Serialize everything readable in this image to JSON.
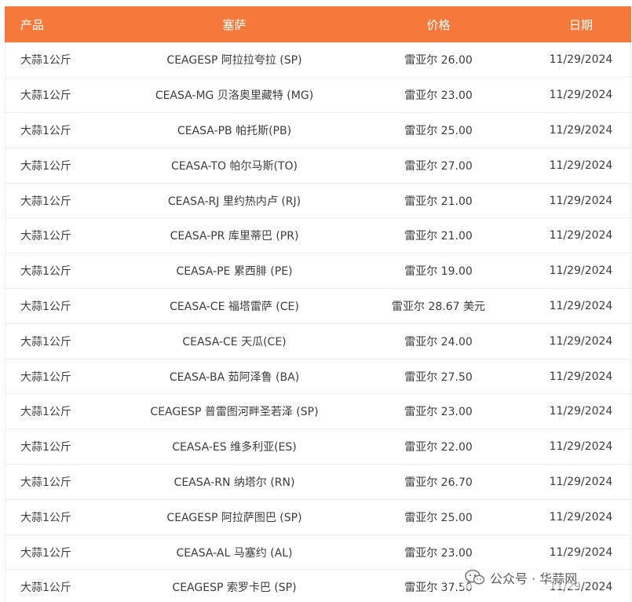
{
  "table": {
    "headers": {
      "product": "产品",
      "market": "塞萨",
      "price": "价格",
      "date": "日期"
    },
    "rows": [
      {
        "product": "大蒜1公斤",
        "market": "CEAGESP 阿拉拉夸拉 (SP)",
        "price": "雷亚尔 26.00",
        "date": "11/29/2024"
      },
      {
        "product": "大蒜1公斤",
        "market": "CEASA-MG 贝洛奥里藏特 (MG)",
        "price": "雷亚尔 23.00",
        "date": "11/29/2024"
      },
      {
        "product": "大蒜1公斤",
        "market": "CEASA-PB 帕托斯(PB)",
        "price": "雷亚尔 25.00",
        "date": "11/29/2024"
      },
      {
        "product": "大蒜1公斤",
        "market": "CEASA-TO 帕尔马斯(TO)",
        "price": "雷亚尔 27.00",
        "date": "11/29/2024"
      },
      {
        "product": "大蒜1公斤",
        "market": "CEASA-RJ 里约热内卢 (RJ)",
        "price": "雷亚尔 21.00",
        "date": "11/29/2024"
      },
      {
        "product": "大蒜1公斤",
        "market": "CEASA-PR 库里蒂巴 (PR)",
        "price": "雷亚尔 21.00",
        "date": "11/29/2024"
      },
      {
        "product": "大蒜1公斤",
        "market": "CEASA-PE 累西腓 (PE)",
        "price": "雷亚尔 19.00",
        "date": "11/29/2024"
      },
      {
        "product": "大蒜1公斤",
        "market": "CEASA-CE 福塔雷萨 (CE)",
        "price": "雷亚尔 28.67 美元",
        "date": "11/29/2024"
      },
      {
        "product": "大蒜1公斤",
        "market": "CEASA-CE 天瓜(CE)",
        "price": "雷亚尔 24.00",
        "date": "11/29/2024"
      },
      {
        "product": "大蒜1公斤",
        "market": "CEASA-BA 茹阿泽鲁 (BA)",
        "price": "雷亚尔 27.50",
        "date": "11/29/2024"
      },
      {
        "product": "大蒜1公斤",
        "market": "CEAGESP 普雷图河畔圣若泽 (SP)",
        "price": "雷亚尔 23.00",
        "date": "11/29/2024"
      },
      {
        "product": "大蒜1公斤",
        "market": "CEASA-ES 维多利亚(ES)",
        "price": "雷亚尔 22.00",
        "date": "11/29/2024"
      },
      {
        "product": "大蒜1公斤",
        "market": "CEASA-RN 纳塔尔 (RN)",
        "price": "雷亚尔 26.70",
        "date": "11/29/2024"
      },
      {
        "product": "大蒜1公斤",
        "market": "CEAGESP 阿拉萨图巴 (SP)",
        "price": "雷亚尔 25.00",
        "date": "11/29/2024"
      },
      {
        "product": "大蒜1公斤",
        "market": "CEASA-AL 马塞约 (AL)",
        "price": "雷亚尔 23.00",
        "date": "11/29/2024"
      },
      {
        "product": "大蒜1公斤",
        "market": "CEAGESP 索罗卡巴 (SP)",
        "price": "雷亚尔 37.50",
        "date": "11/29/2024"
      }
    ]
  },
  "watermark": {
    "text": "公众号 · 华蒜网",
    "icon": "wechat-icon"
  },
  "colors": {
    "header_bg": "#f4793a",
    "header_text": "#ffffff"
  }
}
